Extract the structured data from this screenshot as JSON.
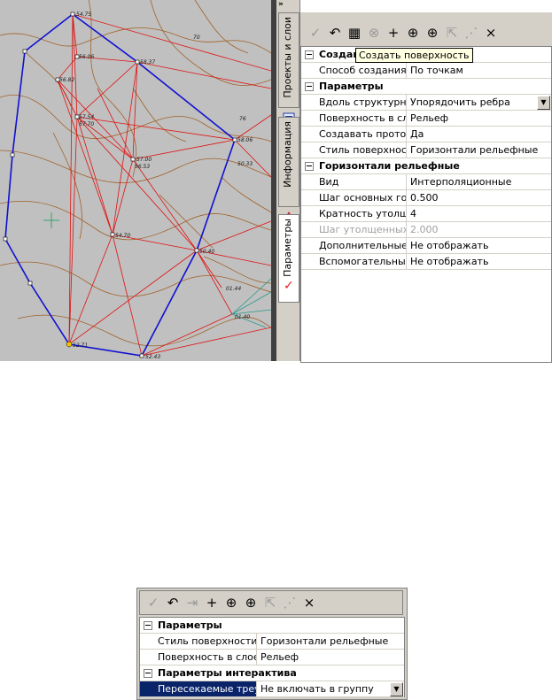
{
  "map": {
    "point_labels": [
      "54.75",
      "56.06",
      "56.82",
      "57.54",
      "57.70",
      "57.00",
      "56.53",
      "58.37",
      "58.06",
      "50.33",
      "54.70",
      "50.40",
      "01.44",
      "01.40",
      "52.71",
      "52.43",
      "70",
      "76"
    ],
    "crosshair_icon": "plus-crosshair"
  },
  "sidetabs": {
    "collapse_glyph": "»",
    "tabs": [
      {
        "label": "Проекты и слои",
        "icon": "layers-icon"
      },
      {
        "label": "Информация",
        "icon": "info-icon"
      },
      {
        "label": "Параметры",
        "icon": "check-icon"
      }
    ]
  },
  "panel": {
    "toolbar": [
      {
        "name": "apply-icon",
        "glyph": "✓",
        "dim": true
      },
      {
        "name": "undo-icon",
        "glyph": "↶",
        "dim": false
      },
      {
        "name": "create-surface-icon",
        "glyph": "▦",
        "dim": false
      },
      {
        "name": "cancel-icon",
        "glyph": "⊗",
        "dim": true
      },
      {
        "name": "add-point-icon",
        "glyph": "+",
        "dim": false
      },
      {
        "name": "capture-point-icon",
        "glyph": "⊕",
        "dim": false
      },
      {
        "name": "move-point-icon",
        "glyph": "⊕",
        "dim": false
      },
      {
        "name": "select-icon",
        "glyph": "⇱",
        "dim": true
      },
      {
        "name": "grid-select-icon",
        "glyph": "⋰",
        "dim": true
      },
      {
        "name": "close-icon",
        "glyph": "×",
        "dim": false
      }
    ],
    "tooltip": "Создать поверхность",
    "sections": [
      {
        "title": "Создание",
        "rows": [
          {
            "label": "Способ создания",
            "value": "По точкам"
          }
        ]
      },
      {
        "title": "Параметры",
        "rows": [
          {
            "label": "Вдоль структурных ...",
            "value": "Упорядочить ребра",
            "dropdown": true
          },
          {
            "label": "Поверхность в слое",
            "value": "Рельеф"
          },
          {
            "label": "Создавать протокол",
            "value": "Да"
          },
          {
            "label": "Стиль поверхности",
            "value": "Горизонтали рельефные"
          }
        ]
      },
      {
        "title": "Горизонтали рельефные",
        "rows": [
          {
            "label": "Вид",
            "value": "Интерполяционные"
          },
          {
            "label": "Шаг основных гориз...",
            "value": "0.500"
          },
          {
            "label": "Кратность утолщения",
            "value": "4"
          },
          {
            "label": "Шаг утолщенных го...",
            "value": "2.000",
            "disabled": true
          },
          {
            "label": "Дополнительные го...",
            "value": "Не отображать"
          },
          {
            "label": "Вспомогательные г...",
            "value": "Не отображать"
          }
        ]
      }
    ]
  },
  "panel2": {
    "toolbar": [
      {
        "name": "apply-icon",
        "glyph": "✓",
        "dim": true
      },
      {
        "name": "undo-icon",
        "glyph": "↶",
        "dim": false
      },
      {
        "name": "step-icon",
        "glyph": "⇥",
        "dim": true
      },
      {
        "name": "add-point-icon",
        "glyph": "+",
        "dim": false
      },
      {
        "name": "capture-point-icon",
        "glyph": "⊕",
        "dim": false
      },
      {
        "name": "move-point-icon",
        "glyph": "⊕",
        "dim": false
      },
      {
        "name": "select-icon",
        "glyph": "⇱",
        "dim": true
      },
      {
        "name": "grid-select-icon",
        "glyph": "⋰",
        "dim": true
      },
      {
        "name": "close-icon",
        "glyph": "×",
        "dim": false
      }
    ],
    "sections": [
      {
        "title": "Параметры",
        "rows": [
          {
            "label": "Стиль поверхности",
            "value": "Горизонтали рельефные"
          },
          {
            "label": "Поверхность в слое",
            "value": "Рельеф"
          }
        ]
      },
      {
        "title": "Параметры интерактива",
        "rows": [
          {
            "label": "Пересекаемые треу...",
            "value": "Не включать в группу",
            "dropdown": true,
            "selected": true
          }
        ]
      }
    ]
  }
}
